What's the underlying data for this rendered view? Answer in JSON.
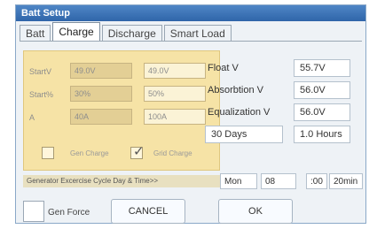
{
  "window": {
    "title": "Batt Setup"
  },
  "tabs": [
    "Batt",
    "Charge",
    "Discharge",
    "Smart Load"
  ],
  "active_tab": "Charge",
  "charge_panel": {
    "start_v": {
      "label": "StartV",
      "value_disabled": "49.0V",
      "value": "49.0V"
    },
    "start_pct": {
      "label": "Start%",
      "value_disabled": "30%",
      "value": "50%"
    },
    "amps": {
      "label": "A",
      "value_disabled": "40A",
      "value": "100A"
    },
    "gen_charge": {
      "label": "Gen Charge",
      "checked": false
    },
    "grid_charge": {
      "label": "Grid Charge",
      "checked": true
    }
  },
  "settings": {
    "float_v": {
      "label": "Float V",
      "value": "55.7V"
    },
    "absorption_v": {
      "label": "Absorbtion V",
      "value": "56.0V"
    },
    "equalization_v": {
      "label": "Equalization V",
      "value": "56.0V"
    },
    "equalization_interval": {
      "days": "30 Days",
      "hours": "1.0 Hours"
    }
  },
  "generator_exercise": {
    "label": "Generator Excercise Cycle Day & Time>>",
    "day": "Mon",
    "hour": "08",
    "minute": ":00",
    "duration": "20min"
  },
  "buttons": {
    "gen_force_label": "Gen Force",
    "cancel": "CANCEL",
    "ok": "OK"
  }
}
